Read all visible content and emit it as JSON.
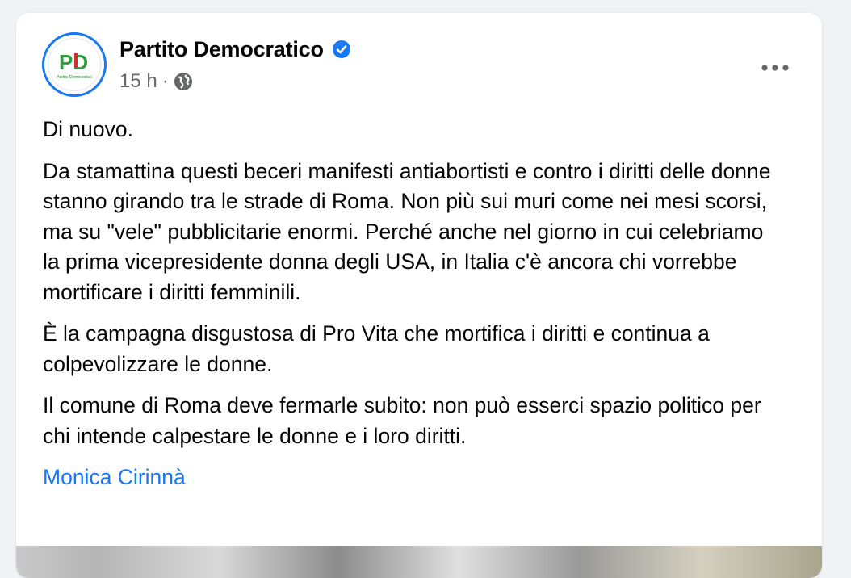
{
  "post": {
    "author": "Partito Democratico",
    "timestamp": "15 h",
    "separator": "·",
    "audience_icon": "globe-icon",
    "verified_icon": "verified-badge-icon",
    "more_icon": "more-options-icon",
    "avatar": {
      "logo_text": "PD",
      "logo_subtext": "Partito Democratico"
    },
    "paragraphs": [
      "Di nuovo.",
      "Da stamattina questi beceri manifesti antiabortisti e contro i diritti delle donne stanno girando tra le strade di Roma. Non più sui muri come nei mesi scorsi, ma su \"vele\" pubblicitarie enormi. Perché anche nel giorno in cui celebriamo la prima vicepresidente donna degli USA, in Italia c'è ancora chi vorrebbe mortificare i diritti femminili.",
      "È la campagna disgustosa di Pro Vita che mortifica i diritti e continua a colpevolizzare le donne.",
      "Il comune di Roma deve fermarle subito: non può esserci spazio politico per chi intende calpestare le donne e i loro diritti."
    ],
    "mention": "Monica Cirinnà"
  },
  "colors": {
    "accent": "#1877f2",
    "text": "#050505",
    "secondary_text": "#65676b",
    "background": "#f0f2f5",
    "pd_green": "#2e9e3f",
    "pd_red": "#d32f2f"
  }
}
